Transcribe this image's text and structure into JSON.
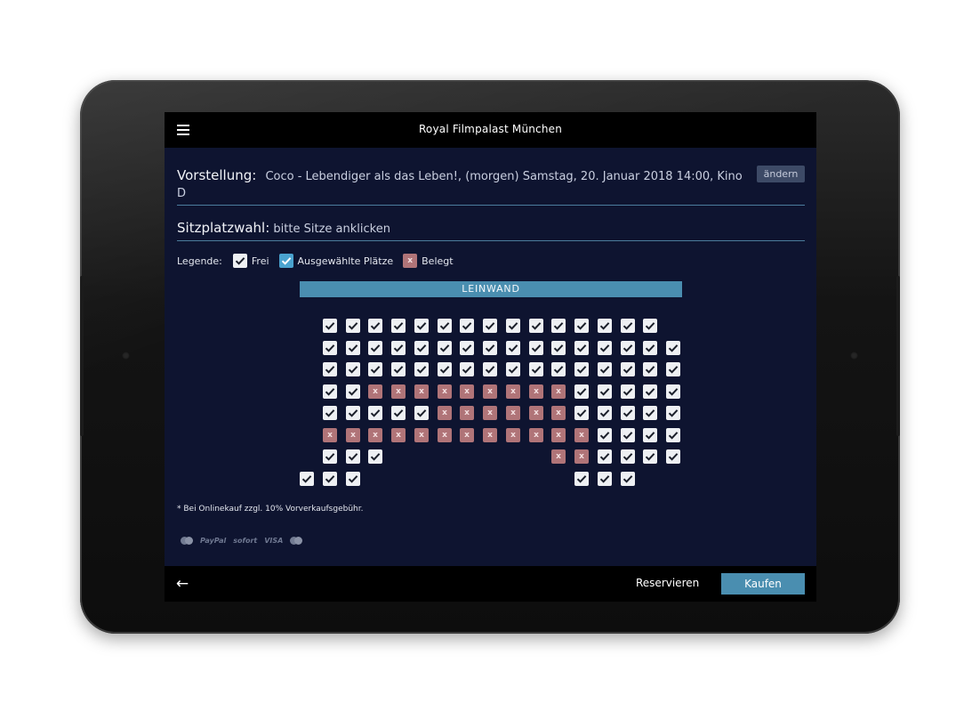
{
  "app": {
    "title": "Royal Filmpalast München"
  },
  "performance": {
    "label": "Vorstellung:",
    "text": "Coco - Lebendiger als das Leben!, (morgen) Samstag, 20. Januar 2018 14:00, Kino D",
    "change_label": "ändern"
  },
  "seat_selection": {
    "label": "Sitzplatzwahl:",
    "hint": "bitte Sitze anklicken"
  },
  "legend": {
    "label": "Legende:",
    "free": "Frei",
    "selected": "Ausgewählte Plätze",
    "occupied": "Belegt"
  },
  "screen_label": "LEINWAND",
  "seat_map": {
    "rows": [
      {
        "free": [
          2,
          3,
          4,
          5,
          6,
          7,
          8,
          9,
          10,
          11,
          12,
          13,
          14,
          15,
          16
        ],
        "occupied": []
      },
      {
        "free": [
          2,
          3,
          4,
          5,
          6,
          7,
          8,
          9,
          10,
          11,
          12,
          13,
          14,
          15,
          16,
          17
        ],
        "occupied": []
      },
      {
        "free": [
          2,
          3,
          4,
          5,
          6,
          7,
          8,
          9,
          10,
          11,
          12,
          13,
          14,
          15,
          16,
          17
        ],
        "occupied": []
      },
      {
        "free": [
          2,
          3,
          13,
          14,
          15,
          16,
          17
        ],
        "occupied": [
          4,
          5,
          6,
          7,
          8,
          9,
          10,
          11,
          12
        ]
      },
      {
        "free": [
          2,
          3,
          4,
          5,
          6,
          13,
          14,
          15,
          16,
          17
        ],
        "occupied": [
          7,
          8,
          9,
          10,
          11,
          12
        ]
      },
      {
        "free": [
          14,
          15,
          16,
          17
        ],
        "occupied": [
          2,
          3,
          4,
          5,
          6,
          7,
          8,
          9,
          10,
          11,
          12,
          13
        ]
      },
      {
        "free": [
          2,
          3,
          4,
          14,
          15,
          16,
          17
        ],
        "occupied": [
          12,
          13
        ]
      },
      {
        "free": [
          1,
          2,
          3,
          13,
          14,
          15
        ],
        "occupied": []
      }
    ],
    "occupied_mark": "x"
  },
  "fee_note": "* Bei Onlinekauf zzgl. 10% Vorverkaufsgebühr.",
  "payment_methods": [
    "PayPal",
    "sofort",
    "VISA"
  ],
  "actions": {
    "reserve": "Reservieren",
    "buy": "Kaufen"
  },
  "colors": {
    "screen_background": "#0e1430",
    "accent": "#4a8eb0",
    "seat_free": "#eef0f3",
    "seat_selected": "#4aa3cf",
    "seat_occupied": "#b07478"
  },
  "icons": {
    "menu": "hamburger-menu-icon",
    "back": "back-arrow-icon",
    "check": "check-icon"
  }
}
